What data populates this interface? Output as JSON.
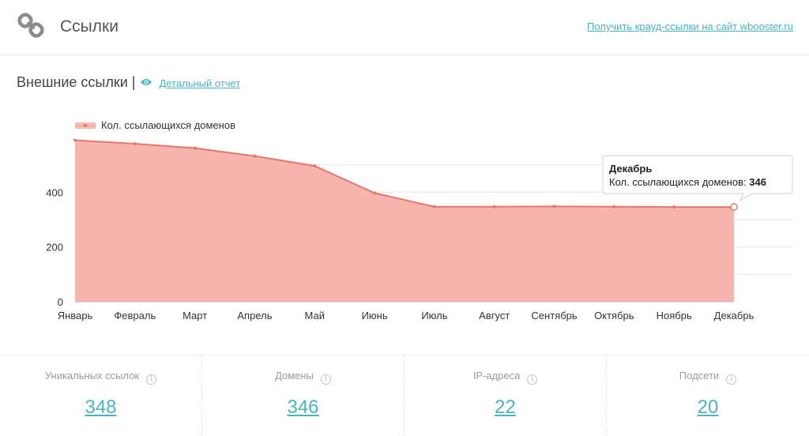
{
  "header": {
    "title": "Ссылки",
    "logo_icon": "chain-link-icon",
    "crowd_link": "Получить крауд-ссылки на сайт wbooster.ru"
  },
  "section": {
    "title": "Внешние ссылки",
    "separator": "|",
    "report_icon": "eye-icon",
    "report_link": "Детальный отчет"
  },
  "chart_data": {
    "type": "area",
    "categories": [
      "Январь",
      "Февраль",
      "Март",
      "Апрель",
      "Май",
      "Июнь",
      "Июль",
      "Август",
      "Сентябрь",
      "Октябрь",
      "Ноябрь",
      "Декабрь"
    ],
    "series": [
      {
        "name": "Кол. ссылающихся доменов",
        "values": [
          590,
          577,
          561,
          532,
          496,
          397,
          347,
          347,
          348,
          347,
          346,
          346
        ]
      }
    ],
    "yticks": [
      0,
      200,
      400
    ],
    "ylim": [
      0,
      600
    ],
    "grid": true,
    "legend_position": "top-left",
    "colors": {
      "fill": "#f7b3ad",
      "line": "#e8766a",
      "grid": "#e6e6e6"
    },
    "tooltip": {
      "title": "Декабрь",
      "label": "Кол. ссылающихся доменов: ",
      "value": "346"
    }
  },
  "stats": [
    {
      "label": "Уникальных ссылок",
      "value": "348",
      "info_icon": "info-icon"
    },
    {
      "label": "Домены",
      "value": "346",
      "info_icon": "info-icon"
    },
    {
      "label": "IP-адреса",
      "value": "22",
      "info_icon": "info-icon"
    },
    {
      "label": "Подсети",
      "value": "20",
      "info_icon": "info-icon"
    }
  ],
  "colors": {
    "accent": "#4cb3c1"
  }
}
